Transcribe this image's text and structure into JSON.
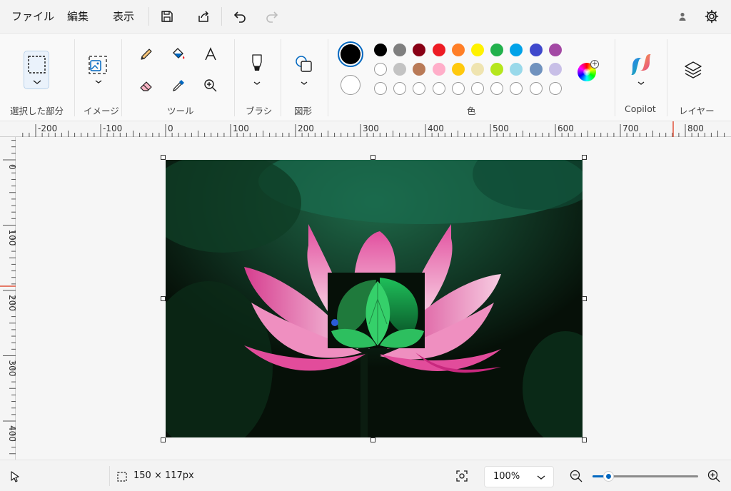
{
  "menu": {
    "file": "ファイル",
    "edit": "編集",
    "view": "表示"
  },
  "icons": {
    "save": "save-icon",
    "share": "share-icon",
    "undo": "undo-icon",
    "redo": "redo-icon",
    "account": "account-icon",
    "settings": "gear-icon"
  },
  "ribbon": {
    "selection_label": "選択した部分",
    "image_label": "イメージ",
    "tools_label": "ツール",
    "brush_label": "ブラシ",
    "shapes_label": "図形",
    "colors_label": "色",
    "copilot_label": "Copilot",
    "layers_label": "レイヤー",
    "primary_color": "#000000",
    "secondary_color": "#ffffff",
    "palette_row1": [
      "#000000",
      "#7f7f7f",
      "#880015",
      "#ed1c24",
      "#ff7f27",
      "#fff200",
      "#22b14c",
      "#00a2e8",
      "#3f48cc",
      "#a349a4"
    ],
    "palette_row2": [
      "#ffffff",
      "#c3c3c3",
      "#b97a57",
      "#ffaec9",
      "#ffc90e",
      "#efe4b0",
      "#b5e61d",
      "#99d9ea",
      "#7092be",
      "#c8bfe7"
    ],
    "palette_row3_empty_count": 10
  },
  "ruler": {
    "top_labels": [
      "-200",
      "-100",
      "0",
      "100",
      "200",
      "300",
      "400",
      "500",
      "600",
      "700",
      "800"
    ],
    "left_labels": [
      "0",
      "100",
      "200",
      "300",
      "400"
    ]
  },
  "status": {
    "selection_size": "150 × 117px",
    "zoom": "100%",
    "zoom_level": 0.15
  },
  "accent_color": "#0067c0"
}
